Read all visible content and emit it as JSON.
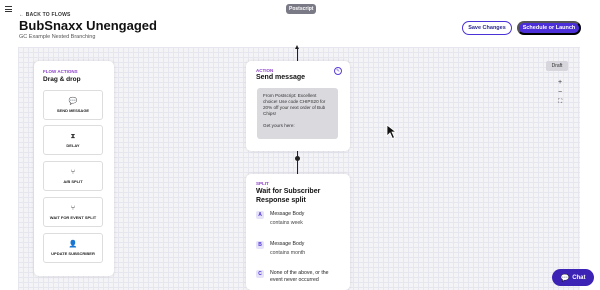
{
  "header": {
    "app_tag": "Postscript",
    "back_link": "BACK TO FLOWS",
    "title": "BubSnaxx Unengaged",
    "subtitle": "GC Example Nested Branching",
    "save_label": "Save Changes",
    "launch_label": "Schedule or Launch"
  },
  "flow_actions": {
    "section_label": "FLOW ACTIONS",
    "title": "Drag & drop",
    "items": [
      {
        "label": "SEND MESSAGE",
        "icon": "message-icon"
      },
      {
        "label": "DELAY",
        "icon": "hourglass-icon"
      },
      {
        "label": "A/B SPLIT",
        "icon": "split-icon"
      },
      {
        "label": "WAIT FOR EVENT SPLIT",
        "icon": "wait-split-icon"
      },
      {
        "label": "UPDATE SUBSCRIBER",
        "icon": "user-icon"
      }
    ]
  },
  "action_card": {
    "kind": "ACTION",
    "title": "Send message",
    "message": "From Postscript: Excellent choice! Use code CHIPS20 for 20% off your next order of Bub Chips!",
    "message_tail": "Get yours here:"
  },
  "split_card": {
    "kind": "SPLIT",
    "title": "Wait for Subscriber Response split",
    "branches": [
      {
        "letter": "A",
        "title": "Message Body",
        "sub": "contains week"
      },
      {
        "letter": "B",
        "title": "Message Body",
        "sub": "contains month"
      },
      {
        "letter": "C",
        "title": "None of the above, or the event never occurred",
        "sub": ""
      }
    ]
  },
  "canvas": {
    "status_badge": "Draft",
    "zoom_in": "+",
    "zoom_out": "−",
    "fit": "⛶"
  },
  "chat": {
    "label": "Chat"
  },
  "colors": {
    "accent": "#4c2fd8",
    "label_purple": "#8b3fc7",
    "chat": "#3d23b5"
  }
}
